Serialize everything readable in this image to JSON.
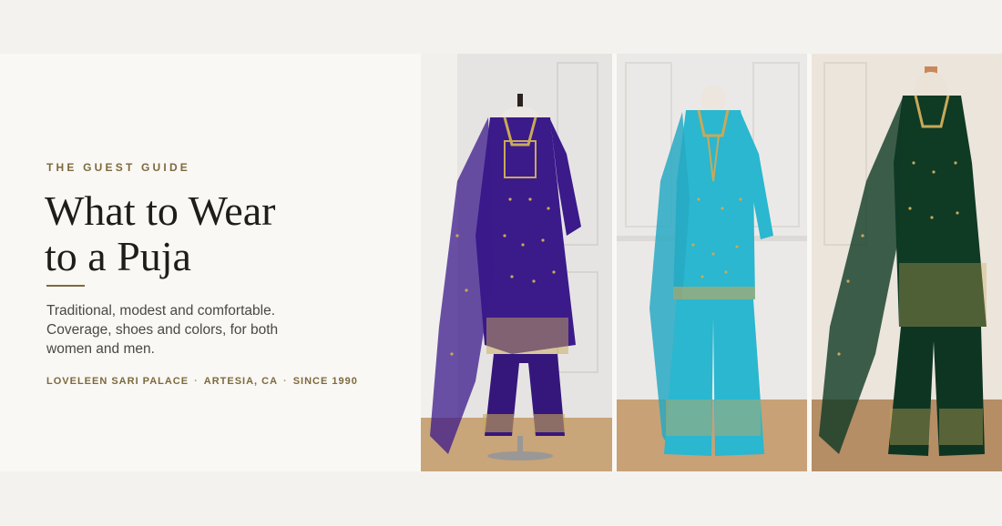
{
  "guide": {
    "eyebrow": "THE GUEST GUIDE",
    "title_line1": "What to Wear",
    "title_line2": "to a Puja",
    "subtitle": "Traditional, modest and comfortable. Coverage, shoes and colors, for both women and men.",
    "meta": {
      "store": "LOVELEEN SARI PALACE",
      "location": "ARTESIA, CA",
      "since": "SINCE 1990",
      "separator": "·"
    }
  },
  "colors": {
    "accent": "#7c6a3e",
    "outfit_purple": "#3b1a8a",
    "outfit_turquoise": "#2ab7cf",
    "outfit_green": "#0f3a24",
    "gold_embroidery": "#c8a95a"
  }
}
